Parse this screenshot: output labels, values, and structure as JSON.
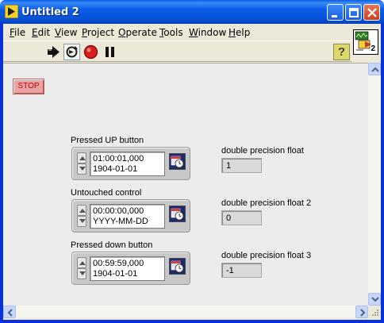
{
  "window": {
    "title": "Untitled 2"
  },
  "menu": [
    "File",
    "Edit",
    "View",
    "Project",
    "Operate",
    "Tools",
    "Window",
    "Help"
  ],
  "menu_underline": [
    "F",
    "E",
    "V",
    "P",
    "O",
    "T",
    "W",
    "H"
  ],
  "toolbar": {
    "help_label": "?"
  },
  "vi_icon": {
    "number": "2"
  },
  "stop_button": {
    "label": "STOP"
  },
  "controls": [
    {
      "label": "Pressed UP button",
      "time": "01:00:01,000",
      "date": "1904-01-01"
    },
    {
      "label": "Untouched control",
      "time": "00:00:00,000",
      "date": "YYYY-MM-DD"
    },
    {
      "label": "Pressed down button",
      "time": "00:59:59,000",
      "date": "1904-01-01"
    }
  ],
  "indicators": [
    {
      "label": "double precision float",
      "value": "1"
    },
    {
      "label": "double precision float 2",
      "value": "0"
    },
    {
      "label": "double precision float 3",
      "value": "-1"
    }
  ]
}
